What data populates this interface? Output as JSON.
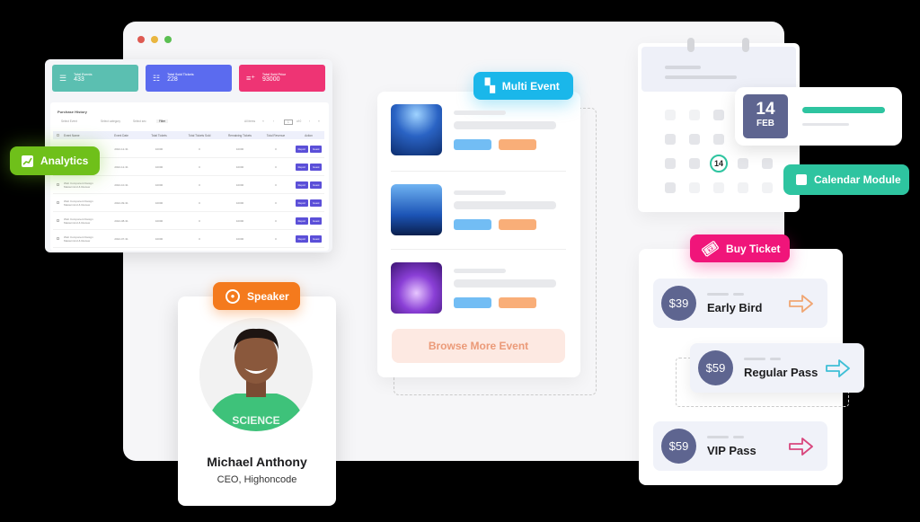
{
  "window": {
    "controls": [
      "close",
      "minimize",
      "maximize"
    ]
  },
  "dashboard": {
    "stats": [
      {
        "label": "Total Events",
        "value": "433",
        "icon": "list-icon",
        "color": "#5bbfb1"
      },
      {
        "label": "Total Sold Tickets",
        "value": "228",
        "icon": "checklist-icon",
        "color": "#5b6bef"
      },
      {
        "label": "Total Sold Price",
        "value": "93000",
        "icon": "add-list-icon",
        "color": "#ee3474"
      }
    ],
    "table": {
      "title": "Purchase History",
      "filters": {
        "event": "Select Event",
        "category": "Select category",
        "status": "Select sec",
        "filter_button": "Filter",
        "all_items": "All items",
        "page": "1",
        "of": "of 0"
      },
      "columns": [
        "Event Name",
        "Event Date",
        "Total Tickets",
        "Total Tickets Sold",
        "Remaining Tickets",
        "Total Revenue",
        "Action"
      ],
      "rows": [
        {
          "name": "",
          "date": "2022-12-31",
          "total": "10000",
          "sold": "0",
          "remaining": "10000",
          "revenue": "0"
        },
        {
          "name": "",
          "date": "2022-12-31",
          "total": "10000",
          "sold": "0",
          "remaining": "10000",
          "revenue": "0"
        },
        {
          "name": "Web Component Design Mastermind & Review",
          "date": "2022-10-31",
          "total": "10000",
          "sold": "0",
          "remaining": "10000",
          "revenue": "0"
        },
        {
          "name": "Web Component Design Mastermind & Review",
          "date": "2022-09-31",
          "total": "10000",
          "sold": "0",
          "remaining": "10000",
          "revenue": "0"
        },
        {
          "name": "Web Component Design Mastermind & Review",
          "date": "2022-08-31",
          "total": "10000",
          "sold": "0",
          "remaining": "10000",
          "revenue": "0"
        },
        {
          "name": "Web Component Design Mastermind & Review",
          "date": "2022-07-31",
          "total": "10000",
          "sold": "0",
          "remaining": "10000",
          "revenue": "0"
        }
      ],
      "actions": {
        "report": "Report",
        "guest": "Guest"
      }
    }
  },
  "tags": {
    "analytics": "Analytics",
    "speaker": "Speaker",
    "multi_event": "Multi Event",
    "calendar_module": "Calendar Module",
    "buy_ticket": "Buy Ticket"
  },
  "speaker": {
    "name": "Michael Anthony",
    "role": "CEO, Highoncode",
    "shirt_text": "SCIENCE"
  },
  "multi_event": {
    "events": [
      {
        "image": "concert-crowd-blue"
      },
      {
        "image": "stage-lights-blue"
      },
      {
        "image": "crowd-purple"
      }
    ],
    "browse_button": "Browse More Event"
  },
  "calendar": {
    "day": "14",
    "month": "FEB",
    "highlighted_day": "14"
  },
  "tickets": [
    {
      "price": "$39",
      "name": "Early Bird",
      "arrow_color": "#f0a673"
    },
    {
      "price": "$59",
      "name": "Regular Pass",
      "arrow_color": "#3fbfd6"
    },
    {
      "price": "$59",
      "name": "VIP Pass",
      "arrow_color": "#d8467d"
    }
  ]
}
